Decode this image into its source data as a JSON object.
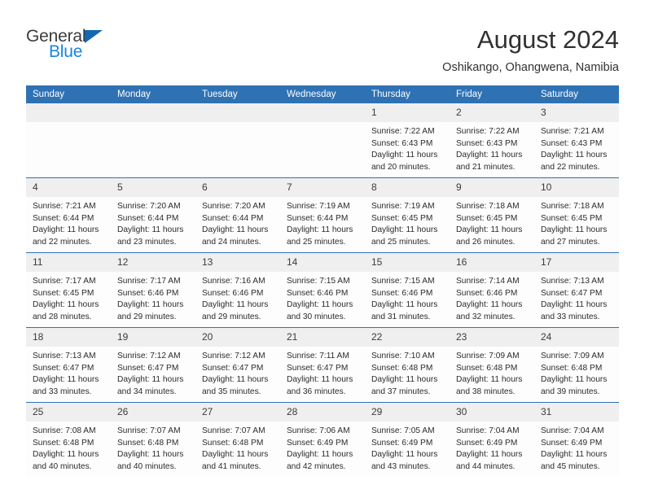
{
  "brand": {
    "name_top": "General",
    "name_bottom": "Blue",
    "triangle_icon": "triangle-icon",
    "color_dark": "#3c3c3c",
    "color_blue": "#1a86dd"
  },
  "header": {
    "title": "August 2024",
    "subtitle": "Oshikango, Ohangwena, Namibia"
  },
  "theme": {
    "header_blue": "#2e72b4",
    "daynum_band": "#efefef",
    "cell_bg": "#fdfdfd",
    "text": "#2b2b2b"
  },
  "calendar": {
    "weekday_headers": [
      "Sunday",
      "Monday",
      "Tuesday",
      "Wednesday",
      "Thursday",
      "Friday",
      "Saturday"
    ],
    "weeks": [
      [
        {
          "day": "",
          "sunrise": "",
          "sunset": "",
          "daylight1": "",
          "daylight2": ""
        },
        {
          "day": "",
          "sunrise": "",
          "sunset": "",
          "daylight1": "",
          "daylight2": ""
        },
        {
          "day": "",
          "sunrise": "",
          "sunset": "",
          "daylight1": "",
          "daylight2": ""
        },
        {
          "day": "",
          "sunrise": "",
          "sunset": "",
          "daylight1": "",
          "daylight2": ""
        },
        {
          "day": "1",
          "sunrise": "Sunrise: 7:22 AM",
          "sunset": "Sunset: 6:43 PM",
          "daylight1": "Daylight: 11 hours",
          "daylight2": "and 20 minutes."
        },
        {
          "day": "2",
          "sunrise": "Sunrise: 7:22 AM",
          "sunset": "Sunset: 6:43 PM",
          "daylight1": "Daylight: 11 hours",
          "daylight2": "and 21 minutes."
        },
        {
          "day": "3",
          "sunrise": "Sunrise: 7:21 AM",
          "sunset": "Sunset: 6:43 PM",
          "daylight1": "Daylight: 11 hours",
          "daylight2": "and 22 minutes."
        }
      ],
      [
        {
          "day": "4",
          "sunrise": "Sunrise: 7:21 AM",
          "sunset": "Sunset: 6:44 PM",
          "daylight1": "Daylight: 11 hours",
          "daylight2": "and 22 minutes."
        },
        {
          "day": "5",
          "sunrise": "Sunrise: 7:20 AM",
          "sunset": "Sunset: 6:44 PM",
          "daylight1": "Daylight: 11 hours",
          "daylight2": "and 23 minutes."
        },
        {
          "day": "6",
          "sunrise": "Sunrise: 7:20 AM",
          "sunset": "Sunset: 6:44 PM",
          "daylight1": "Daylight: 11 hours",
          "daylight2": "and 24 minutes."
        },
        {
          "day": "7",
          "sunrise": "Sunrise: 7:19 AM",
          "sunset": "Sunset: 6:44 PM",
          "daylight1": "Daylight: 11 hours",
          "daylight2": "and 25 minutes."
        },
        {
          "day": "8",
          "sunrise": "Sunrise: 7:19 AM",
          "sunset": "Sunset: 6:45 PM",
          "daylight1": "Daylight: 11 hours",
          "daylight2": "and 25 minutes."
        },
        {
          "day": "9",
          "sunrise": "Sunrise: 7:18 AM",
          "sunset": "Sunset: 6:45 PM",
          "daylight1": "Daylight: 11 hours",
          "daylight2": "and 26 minutes."
        },
        {
          "day": "10",
          "sunrise": "Sunrise: 7:18 AM",
          "sunset": "Sunset: 6:45 PM",
          "daylight1": "Daylight: 11 hours",
          "daylight2": "and 27 minutes."
        }
      ],
      [
        {
          "day": "11",
          "sunrise": "Sunrise: 7:17 AM",
          "sunset": "Sunset: 6:45 PM",
          "daylight1": "Daylight: 11 hours",
          "daylight2": "and 28 minutes."
        },
        {
          "day": "12",
          "sunrise": "Sunrise: 7:17 AM",
          "sunset": "Sunset: 6:46 PM",
          "daylight1": "Daylight: 11 hours",
          "daylight2": "and 29 minutes."
        },
        {
          "day": "13",
          "sunrise": "Sunrise: 7:16 AM",
          "sunset": "Sunset: 6:46 PM",
          "daylight1": "Daylight: 11 hours",
          "daylight2": "and 29 minutes."
        },
        {
          "day": "14",
          "sunrise": "Sunrise: 7:15 AM",
          "sunset": "Sunset: 6:46 PM",
          "daylight1": "Daylight: 11 hours",
          "daylight2": "and 30 minutes."
        },
        {
          "day": "15",
          "sunrise": "Sunrise: 7:15 AM",
          "sunset": "Sunset: 6:46 PM",
          "daylight1": "Daylight: 11 hours",
          "daylight2": "and 31 minutes."
        },
        {
          "day": "16",
          "sunrise": "Sunrise: 7:14 AM",
          "sunset": "Sunset: 6:46 PM",
          "daylight1": "Daylight: 11 hours",
          "daylight2": "and 32 minutes."
        },
        {
          "day": "17",
          "sunrise": "Sunrise: 7:13 AM",
          "sunset": "Sunset: 6:47 PM",
          "daylight1": "Daylight: 11 hours",
          "daylight2": "and 33 minutes."
        }
      ],
      [
        {
          "day": "18",
          "sunrise": "Sunrise: 7:13 AM",
          "sunset": "Sunset: 6:47 PM",
          "daylight1": "Daylight: 11 hours",
          "daylight2": "and 33 minutes."
        },
        {
          "day": "19",
          "sunrise": "Sunrise: 7:12 AM",
          "sunset": "Sunset: 6:47 PM",
          "daylight1": "Daylight: 11 hours",
          "daylight2": "and 34 minutes."
        },
        {
          "day": "20",
          "sunrise": "Sunrise: 7:12 AM",
          "sunset": "Sunset: 6:47 PM",
          "daylight1": "Daylight: 11 hours",
          "daylight2": "and 35 minutes."
        },
        {
          "day": "21",
          "sunrise": "Sunrise: 7:11 AM",
          "sunset": "Sunset: 6:47 PM",
          "daylight1": "Daylight: 11 hours",
          "daylight2": "and 36 minutes."
        },
        {
          "day": "22",
          "sunrise": "Sunrise: 7:10 AM",
          "sunset": "Sunset: 6:48 PM",
          "daylight1": "Daylight: 11 hours",
          "daylight2": "and 37 minutes."
        },
        {
          "day": "23",
          "sunrise": "Sunrise: 7:09 AM",
          "sunset": "Sunset: 6:48 PM",
          "daylight1": "Daylight: 11 hours",
          "daylight2": "and 38 minutes."
        },
        {
          "day": "24",
          "sunrise": "Sunrise: 7:09 AM",
          "sunset": "Sunset: 6:48 PM",
          "daylight1": "Daylight: 11 hours",
          "daylight2": "and 39 minutes."
        }
      ],
      [
        {
          "day": "25",
          "sunrise": "Sunrise: 7:08 AM",
          "sunset": "Sunset: 6:48 PM",
          "daylight1": "Daylight: 11 hours",
          "daylight2": "and 40 minutes."
        },
        {
          "day": "26",
          "sunrise": "Sunrise: 7:07 AM",
          "sunset": "Sunset: 6:48 PM",
          "daylight1": "Daylight: 11 hours",
          "daylight2": "and 40 minutes."
        },
        {
          "day": "27",
          "sunrise": "Sunrise: 7:07 AM",
          "sunset": "Sunset: 6:48 PM",
          "daylight1": "Daylight: 11 hours",
          "daylight2": "and 41 minutes."
        },
        {
          "day": "28",
          "sunrise": "Sunrise: 7:06 AM",
          "sunset": "Sunset: 6:49 PM",
          "daylight1": "Daylight: 11 hours",
          "daylight2": "and 42 minutes."
        },
        {
          "day": "29",
          "sunrise": "Sunrise: 7:05 AM",
          "sunset": "Sunset: 6:49 PM",
          "daylight1": "Daylight: 11 hours",
          "daylight2": "and 43 minutes."
        },
        {
          "day": "30",
          "sunrise": "Sunrise: 7:04 AM",
          "sunset": "Sunset: 6:49 PM",
          "daylight1": "Daylight: 11 hours",
          "daylight2": "and 44 minutes."
        },
        {
          "day": "31",
          "sunrise": "Sunrise: 7:04 AM",
          "sunset": "Sunset: 6:49 PM",
          "daylight1": "Daylight: 11 hours",
          "daylight2": "and 45 minutes."
        }
      ]
    ]
  }
}
